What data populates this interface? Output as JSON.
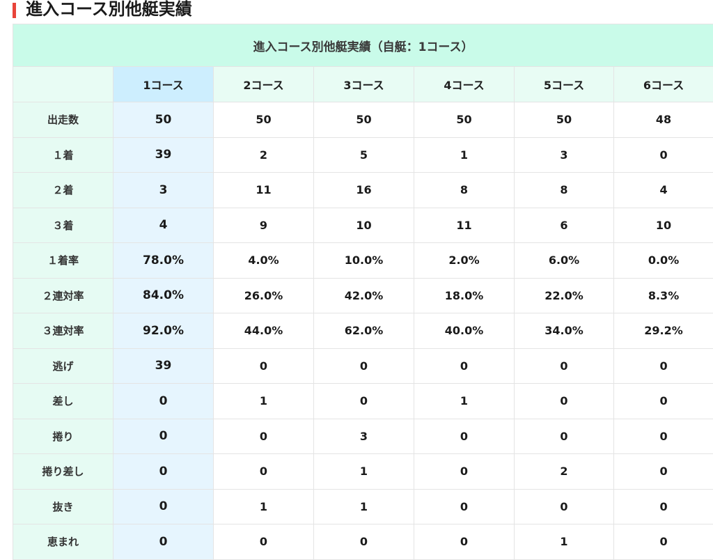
{
  "heading": "進入コース別他艇実績",
  "table": {
    "caption": "進入コース別他艇実績（自艇：1コース）",
    "headers": [
      "1コース",
      "2コース",
      "3コース",
      "4コース",
      "5コース",
      "6コース"
    ],
    "rows": [
      {
        "label": "出走数",
        "values": [
          "50",
          "50",
          "50",
          "50",
          "50",
          "48"
        ]
      },
      {
        "label": "１着",
        "values": [
          "39",
          "2",
          "5",
          "1",
          "3",
          "0"
        ]
      },
      {
        "label": "２着",
        "values": [
          "3",
          "11",
          "16",
          "8",
          "8",
          "4"
        ]
      },
      {
        "label": "３着",
        "values": [
          "4",
          "9",
          "10",
          "11",
          "6",
          "10"
        ]
      },
      {
        "label": "１着率",
        "values": [
          "78.0%",
          "4.0%",
          "10.0%",
          "2.0%",
          "6.0%",
          "0.0%"
        ]
      },
      {
        "label": "２連対率",
        "values": [
          "84.0%",
          "26.0%",
          "42.0%",
          "18.0%",
          "22.0%",
          "8.3%"
        ]
      },
      {
        "label": "３連対率",
        "values": [
          "92.0%",
          "44.0%",
          "62.0%",
          "40.0%",
          "34.0%",
          "29.2%"
        ]
      },
      {
        "label": "逃げ",
        "values": [
          "39",
          "0",
          "0",
          "0",
          "0",
          "0"
        ]
      },
      {
        "label": "差し",
        "values": [
          "0",
          "1",
          "0",
          "1",
          "0",
          "0"
        ]
      },
      {
        "label": "捲り",
        "values": [
          "0",
          "0",
          "3",
          "0",
          "0",
          "0"
        ]
      },
      {
        "label": "捲り差し",
        "values": [
          "0",
          "0",
          "1",
          "0",
          "2",
          "0"
        ]
      },
      {
        "label": "抜き",
        "values": [
          "0",
          "1",
          "1",
          "0",
          "0",
          "0"
        ]
      },
      {
        "label": "恵まれ",
        "values": [
          "0",
          "0",
          "0",
          "0",
          "1",
          "0"
        ]
      }
    ]
  },
  "colors": {
    "accent_bar": "#e8443a",
    "caption_bg": "#c9fbe9",
    "own_column_bg": "#e6f5fe",
    "own_header_bg": "#cdeefe"
  }
}
